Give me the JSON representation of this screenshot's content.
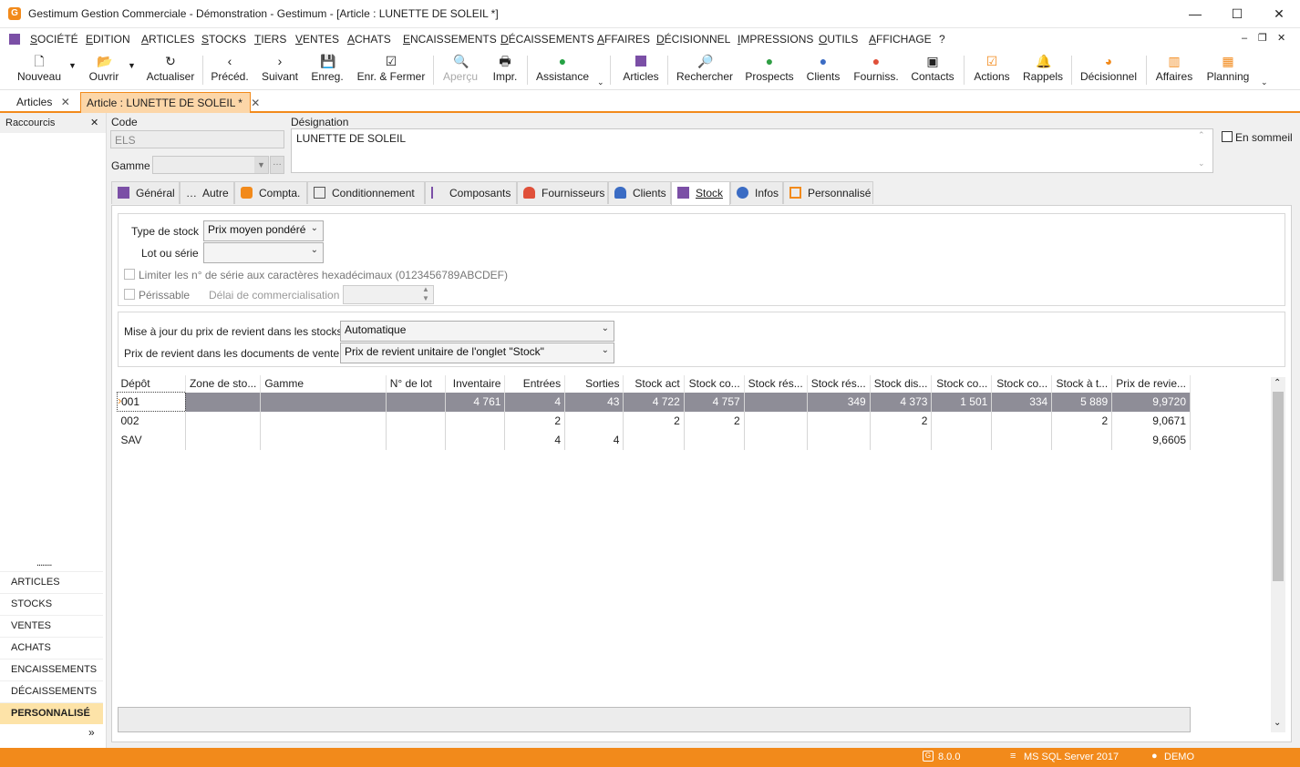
{
  "window": {
    "title": "Gestimum Gestion Commerciale - Démonstration - Gestimum - [Article : LUNETTE DE SOLEIL *]",
    "logo": "G",
    "minimize": "—",
    "maximize": "☐",
    "close": "✕"
  },
  "menu": [
    "SOCIÉTÉ",
    "EDITION",
    "ARTICLES",
    "STOCKS",
    "TIERS",
    "VENTES",
    "ACHATS",
    "ENCAISSEMENTS",
    "DÉCAISSEMENTS",
    "AFFAIRES",
    "DÉCISIONNEL",
    "IMPRESSIONS",
    "OUTILS",
    "AFFICHAGE",
    "?"
  ],
  "toolbar": {
    "nouveau": "Nouveau",
    "ouvrir": "Ouvrir",
    "actualiser": "Actualiser",
    "preced": "Précéd.",
    "suivant": "Suivant",
    "enreg": "Enreg.",
    "enr_fermer": "Enr. & Fermer",
    "apercu": "Aperçu",
    "impr": "Impr.",
    "assistance": "Assistance",
    "articles": "Articles",
    "rechercher": "Rechercher",
    "prospects": "Prospects",
    "clients": "Clients",
    "fourniss": "Fourniss.",
    "contacts": "Contacts",
    "actions": "Actions",
    "rappels": "Rappels",
    "decisionnel": "Décisionnel",
    "affaires": "Affaires",
    "planning": "Planning"
  },
  "tabs": {
    "articles": "Articles",
    "article": "Article : LUNETTE DE SOLEIL *"
  },
  "sidebar": {
    "title": "Raccourcis",
    "dots": "........",
    "items": [
      "ARTICLES",
      "STOCKS",
      "VENTES",
      "ACHATS",
      "ENCAISSEMENTS",
      "DÉCAISSEMENTS",
      "PERSONNALISÉ"
    ],
    "more": "»"
  },
  "header": {
    "code_label": "Code",
    "code_value": "ELS",
    "gamme_label": "Gamme",
    "designation_label": "Désignation",
    "designation_value": "LUNETTE DE SOLEIL",
    "sommeil_label": "En sommeil"
  },
  "inner_tabs": [
    "Général",
    "Autre",
    "Compta.",
    "Conditionnement",
    "Composants",
    "Fournisseurs",
    "Clients",
    "Stock",
    "Infos",
    "Personnalisé"
  ],
  "stock": {
    "type_label": "Type de stock",
    "type_value": "Prix moyen pondéré",
    "lot_label": "Lot ou série",
    "lot_value": "",
    "limiter_label": "Limiter les n° de série aux caractères hexadécimaux (0123456789ABCDEF)",
    "perissable_label": "Périssable",
    "delai_label": "Délai de commercialisation",
    "maj_label": "Mise à jour du prix de revient dans les stocks",
    "maj_value": "Automatique",
    "prix_doc_label": "Prix de revient dans les documents de vente",
    "prix_doc_value": "Prix de revient unitaire de l'onglet \"Stock\""
  },
  "grid": {
    "columns": [
      "Dépôt",
      "Zone de sto...",
      "Gamme",
      "N° de lot",
      "Inventaire",
      "Entrées",
      "Sorties",
      "Stock act",
      "Stock co...",
      "Stock rés...",
      "Stock rés...",
      "Stock dis...",
      "Stock co...",
      "Stock co...",
      "Stock à t...",
      "Prix de revie..."
    ],
    "rows": [
      [
        "001",
        "",
        "",
        "",
        "4 761",
        "4",
        "43",
        "4 722",
        "4 757",
        "",
        "349",
        "4 373",
        "1 501",
        "334",
        "5 889",
        "9,9720"
      ],
      [
        "002",
        "",
        "",
        "",
        "",
        "2",
        "",
        "2",
        "2",
        "",
        "",
        "2",
        "",
        "",
        "2",
        "9,0671"
      ],
      [
        "SAV",
        "",
        "",
        "",
        "",
        "4",
        "4",
        "",
        "",
        "",
        "",
        "",
        "",
        "",
        "",
        "9,6605"
      ]
    ],
    "row_marker": "›"
  },
  "status": {
    "version": "8.0.0",
    "db": "MS SQL Server 2017",
    "user": "DEMO"
  },
  "colors": {
    "accent": "#f28a1b",
    "selected_row": "#8e8d97",
    "purple": "#7b4fa6"
  }
}
